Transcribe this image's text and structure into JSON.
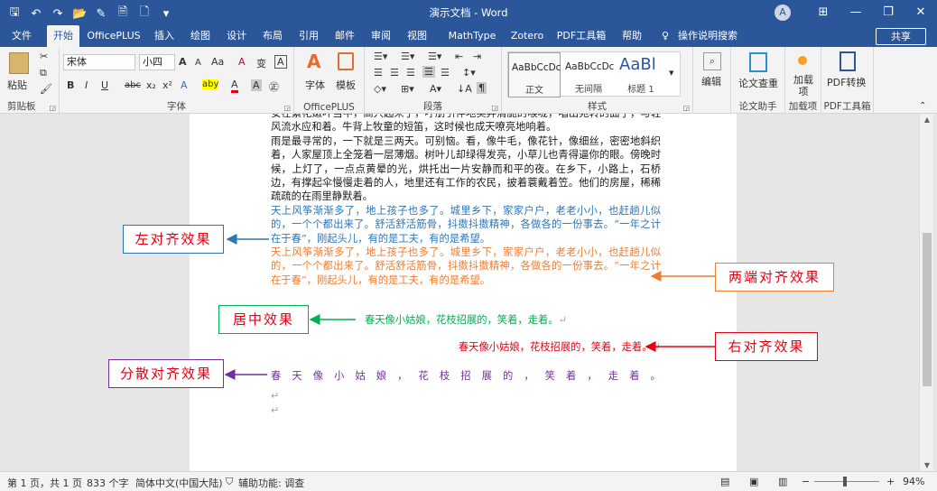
{
  "title": "演示文档 - Word",
  "qat": {
    "save": "🖫",
    "undo": "↶",
    "redo": "↷",
    "open": "📂",
    "print": "✎",
    "preview": "🗎",
    "new": "🗋",
    "more": "▾"
  },
  "window": {
    "user_initial": "A",
    "ribbon_display": "⊞",
    "minimize": "—",
    "restore": "❐",
    "close": "✕"
  },
  "tabs": [
    "文件",
    "开始",
    "OfficePLUS",
    "插入",
    "绘图",
    "设计",
    "布局",
    "引用",
    "邮件",
    "审阅",
    "视图",
    "MathType",
    "Zotero",
    "PDF工具箱",
    "帮助",
    "操作说明搜索"
  ],
  "tab_search_icon": "♀",
  "share": "共享",
  "ribbon": {
    "clipboard": {
      "paste": "粘贴",
      "label": "剪贴板"
    },
    "font": {
      "name": "宋体",
      "size": "小四",
      "grow": "A",
      "shrink": "A",
      "case": "Aa",
      "clear": "A",
      "pinyin": "变",
      "border": "A",
      "bold": "B",
      "italic": "I",
      "underline": "U",
      "strike": "abc",
      "sub": "x₂",
      "sup": "x²",
      "effects": "A",
      "highlight": "aby",
      "color": "A",
      "shade": "A",
      "circle": "㊣",
      "label": "字体"
    },
    "officeplus": {
      "font_btn": "字体",
      "template_btn": "模板",
      "label": "OfficePLUS"
    },
    "paragraph": {
      "label": "段落"
    },
    "styles": {
      "items": [
        {
          "sample": "AaBbCcDc",
          "name": "正文"
        },
        {
          "sample": "AaBbCcDc",
          "name": "无间隔"
        },
        {
          "sample": "AaBl",
          "name": "标题 1"
        }
      ],
      "label": "样式"
    },
    "editing": {
      "label": "编辑"
    },
    "paper_check": {
      "label": "论文查重",
      "group": "论文助手"
    },
    "addins": {
      "label": "加载项",
      "btn": "加载项"
    },
    "pdf": {
      "label": "PDF转换",
      "group": "PDF工具箱"
    }
  },
  "document": {
    "paragraphs": [
      {
        "text": "安在繁花嫩叶当中，高兴起来了，呼朋引伴地卖弄清脆的喉咙，唱出宛转的曲子，与轻风流水应和着。牛背上牧童的短笛，这时候也成天嘹亮地响着。",
        "color": "default"
      },
      {
        "text": "雨是最寻常的，一下就是三两天。可别恼。看，像牛毛，像花针，像细丝，密密地斜织着，人家屋顶上全笼着一层薄烟。树叶儿却绿得发亮，小草儿也青得逼你的眼。傍晚时候，上灯了，一点点黄晕的光，烘托出一片安静而和平的夜。在乡下，小路上，石桥边，有撑起伞慢慢走着的人，地里还有工作的农民，披着蓑戴着笠。他们的房屋，稀稀疏疏的在雨里静默着。",
        "color": "default"
      },
      {
        "text": "天上风筝渐渐多了，地上孩子也多了。城里乡下，家家户户，老老小小，也赶趟儿似的，一个个都出来了。舒活舒活筋骨，抖擞抖擞精神，各做各的一份事去。“一年之计在于春”，刚起头儿，有的是工夫，有的是希望。",
        "color": "blue"
      },
      {
        "text": "天上风筝渐渐多了，地上孩子也多了。城里乡下，家家户户，老老小小，也赶趟儿似的，一个个都出来了。舒活舒活筋骨，抖擞抖擞精神，各做各的一份事去。“一年之计在于春”，刚起头儿，有的是工夫，有的是希望。",
        "color": "orange"
      }
    ],
    "centered": "春天像小姑娘，花枝招展的，笑着，走着。",
    "right": "春天像小姑娘，花枝招展的，笑着，走着。",
    "distributed": [
      "春",
      "天",
      "像",
      "小",
      "姑",
      "娘",
      "，",
      "花",
      "枝",
      "招",
      "展",
      "的",
      "，",
      "笑",
      "着",
      "，",
      "走",
      "着",
      "。"
    ],
    "pilcrow": "↵"
  },
  "callouts": [
    {
      "text": "左对齐效果",
      "color": "#2e75b6"
    },
    {
      "text": "两端对齐效果",
      "color": "#ed7d31"
    },
    {
      "text": "居中效果",
      "color": "#00b050"
    },
    {
      "text": "右对齐效果",
      "color": "#e60012"
    },
    {
      "text": "分散对齐效果",
      "color": "#7030a0"
    }
  ],
  "status": {
    "page": "第 1 页，共 1 页",
    "words": "833 个字",
    "language": "简体中文(中国大陆)",
    "accessibility": "辅助功能: 调查",
    "zoom": "94%",
    "zoom_minus": "−",
    "zoom_plus": "+"
  },
  "colors": {
    "brand": "#2b579a",
    "blue": "#2e75b6",
    "orange": "#ed7d31",
    "green": "#00b050",
    "red": "#e60012",
    "purple": "#7030a0"
  }
}
